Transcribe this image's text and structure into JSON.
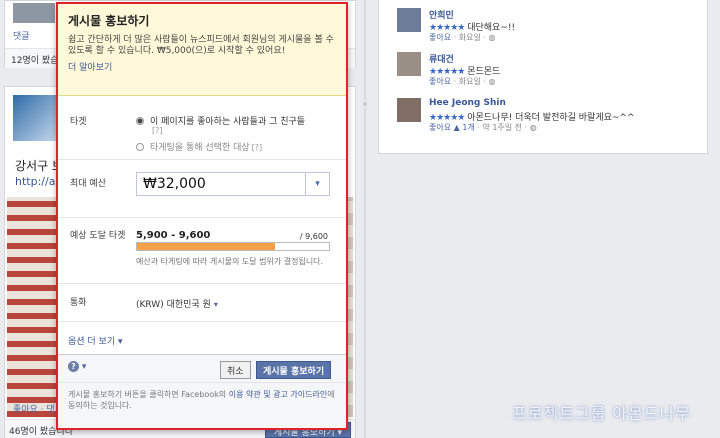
{
  "timeline_left": {
    "top_post": {
      "comment_label": "댓글",
      "count_text": "12명이 봤습니다"
    },
    "main_post": {
      "title": "강서구 보",
      "link": "http://al",
      "like_label": "좋아요 · 댓",
      "viewed_text": "46명이 봤습니다",
      "boost_button": "게시물 홍보하기 ▾"
    }
  },
  "comments": [
    {
      "name": "안희민",
      "stars": "★★★★★",
      "text": "대단해요~!!",
      "meta_like": "좋아요",
      "meta_time": "· 화요일 ·"
    },
    {
      "name": "류대건",
      "stars": "★★★★★",
      "text": "몬드몬드",
      "meta_like": "좋아요",
      "meta_time": "· 화요일 ·"
    },
    {
      "name": "Hee Jeong Shin",
      "stars": "★★★★★",
      "text": "아몬드나무! 더욱더 발전하길 바랄게요~^^",
      "meta_like": "좋아요",
      "meta_count": "1개",
      "meta_time": "· 약 1주일 전 ·"
    }
  ],
  "watermark": "프로젝트그룹 아몬드나무",
  "popup": {
    "title": "게시물 홍보하기",
    "description": "쉽고 간단하게 더 많은 사람들이 뉴스피드에서 회원님의 게시물을 볼 수 있도록 할 수 있습니다. ₩5,000(으)로 시작할 수 있어요!",
    "learn_more": "더 알아보기",
    "target": {
      "label": "타겟",
      "option1": "이 페이지를 좋아하는 사람들과 그 친구들",
      "option2": "타게팅을 통해 선택한 대상",
      "help": "[?]"
    },
    "budget": {
      "label": "최대 예산",
      "value": "₩32,000",
      "arrow": "▾"
    },
    "reach": {
      "label": "예상 도달 타겟",
      "range": "5,900 - 9,600",
      "max": "/ 9,600",
      "fill_fraction": 0.72,
      "note": "예산과 타게팅에 따라 게시물의 도달 범위가 결정됩니다."
    },
    "currency": {
      "label": "통화",
      "value": "(KRW) 대한민국 원",
      "caret": "▾"
    },
    "more_options": "옵션 더 보기 ▾",
    "help_symbol": "?",
    "help_caret": "▾",
    "cancel": "취소",
    "promote": "게시물 홍보하기",
    "legal_prefix": "게시물 홍보하기 버튼을 클릭하면 Facebook의 ",
    "legal_link": "이용 약관 및 광고 가이드라인",
    "legal_suffix": "에 동의하는 것입니다."
  },
  "colors": {
    "popup_border": "#e0232b",
    "header_bg": "#fff8d8",
    "reach_fill": "#f4a24a",
    "fb_blue": "#3b5998"
  }
}
